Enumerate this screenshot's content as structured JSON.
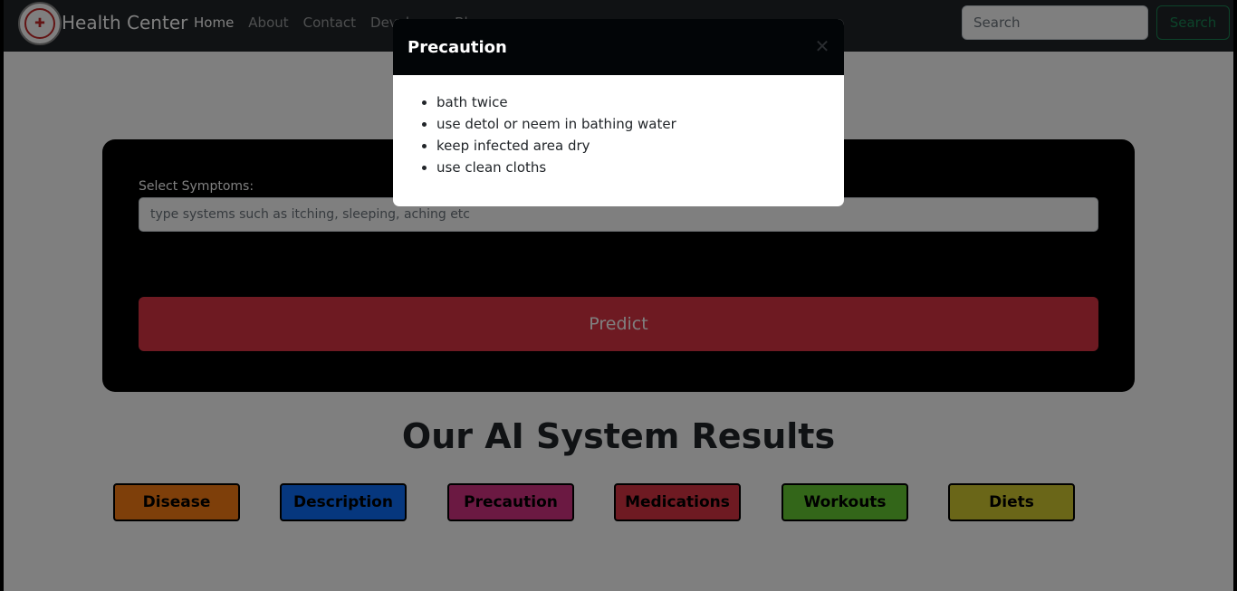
{
  "navbar": {
    "brand": "Health Center",
    "links": [
      "Home",
      "About",
      "Contact",
      "Developer",
      "Blog"
    ],
    "search_placeholder": "Search",
    "search_button": "Search"
  },
  "form": {
    "label": "Select Symptoms:",
    "placeholder": "type systems such as itching, sleeping, aching etc",
    "predict_button": "Predict"
  },
  "results": {
    "title": "Our AI System Results",
    "buttons": [
      {
        "label": "Disease",
        "color": "#fd7e14"
      },
      {
        "label": "Description",
        "color": "#0d6efd"
      },
      {
        "label": "Precaution",
        "color": "#d63384"
      },
      {
        "label": "Medications",
        "color": "#dc3545"
      },
      {
        "label": "Workouts",
        "color": "#66cc33"
      },
      {
        "label": "Diets",
        "color": "#d4cc30"
      }
    ]
  },
  "modal": {
    "title": "Precaution",
    "close_icon": "close-icon",
    "items": [
      "bath twice",
      "use detol or neem in bathing water",
      "keep infected area dry",
      "use clean cloths"
    ]
  }
}
